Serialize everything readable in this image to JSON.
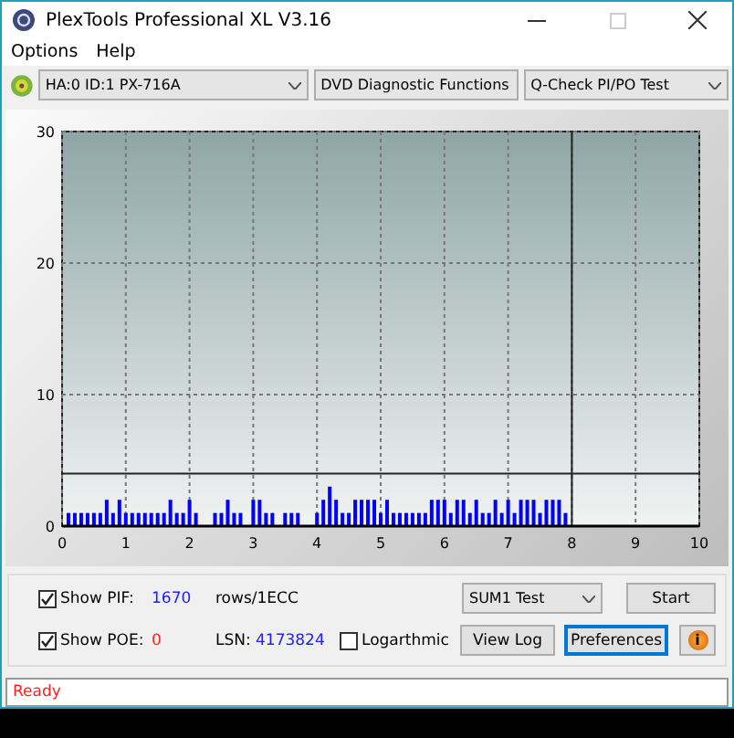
{
  "window": {
    "title": "PlexTools Professional XL V3.16"
  },
  "menu": [
    "Options",
    "Help"
  ],
  "toolbar": {
    "drive": "HA:0 ID:1  PX-716A",
    "function": "DVD Diagnostic Functions",
    "test": "Q-Check PI/PO Test"
  },
  "chart": {
    "chart_data": {
      "type": "bar",
      "x": [
        0.1,
        0.2,
        0.3,
        0.4,
        0.5,
        0.6,
        0.7,
        0.8,
        0.9,
        1.0,
        1.1,
        1.2,
        1.3,
        1.4,
        1.5,
        1.6,
        1.7,
        1.8,
        1.9,
        2.0,
        2.1,
        2.4,
        2.5,
        2.6,
        2.7,
        2.8,
        3.0,
        3.1,
        3.2,
        3.3,
        3.5,
        3.6,
        3.7,
        4.0,
        4.1,
        4.2,
        4.3,
        4.4,
        4.5,
        4.6,
        4.7,
        4.8,
        4.9,
        5.0,
        5.1,
        5.2,
        5.3,
        5.4,
        5.5,
        5.6,
        5.7,
        5.8,
        5.9,
        6.0,
        6.1,
        6.2,
        6.3,
        6.4,
        6.5,
        6.6,
        6.7,
        6.8,
        6.9,
        7.0,
        7.1,
        7.2,
        7.3,
        7.4,
        7.5,
        7.6,
        7.7,
        7.8,
        7.9
      ],
      "series": [
        {
          "color": "#0000ff",
          "values": [
            1,
            1,
            1,
            1,
            1,
            1,
            2,
            1,
            2,
            1,
            1,
            1,
            1,
            1,
            1,
            1,
            2,
            1,
            1,
            2,
            1,
            1,
            1,
            2,
            1,
            1,
            2,
            2,
            1,
            1,
            1,
            1,
            1,
            1,
            2,
            3,
            2,
            1,
            1,
            2,
            2,
            2,
            2,
            1,
            2,
            1,
            1,
            1,
            1,
            1,
            1,
            2,
            2,
            2,
            1,
            2,
            2,
            1,
            2,
            1,
            1,
            2,
            1,
            2,
            1,
            2,
            2,
            2,
            1,
            2,
            2,
            2,
            1
          ]
        }
      ],
      "xlim": [
        0,
        10
      ],
      "ylim": [
        0,
        30
      ],
      "xticks": [
        0,
        1,
        2,
        3,
        4,
        5,
        6,
        7,
        8,
        9,
        10
      ],
      "yticks": [
        0,
        10,
        20,
        30
      ],
      "grid": true,
      "ref_lines": [
        {
          "axis": "y",
          "value": 4
        },
        {
          "axis": "x",
          "value": 8
        }
      ]
    }
  },
  "controls": {
    "show_pif": {
      "label": "Show PIF:",
      "checked": true,
      "value": "1670",
      "unit": "rows/1ECC"
    },
    "show_poe": {
      "label": "Show POE:",
      "checked": true,
      "value": "0"
    },
    "lsn": {
      "label": "LSN:",
      "value": "4173824"
    },
    "logarithmic": {
      "label": "Logarthmic",
      "checked": false
    },
    "test_select": "SUM1 Test",
    "buttons": [
      {
        "kind": "text",
        "label": "Start",
        "focused": false
      },
      {
        "kind": "text",
        "label": "View Log",
        "focused": false
      },
      {
        "kind": "text",
        "label": "Preferences",
        "focused": true
      },
      {
        "kind": "info",
        "label": "i",
        "focused": false
      }
    ]
  },
  "status_bar": {
    "text": "Ready"
  }
}
